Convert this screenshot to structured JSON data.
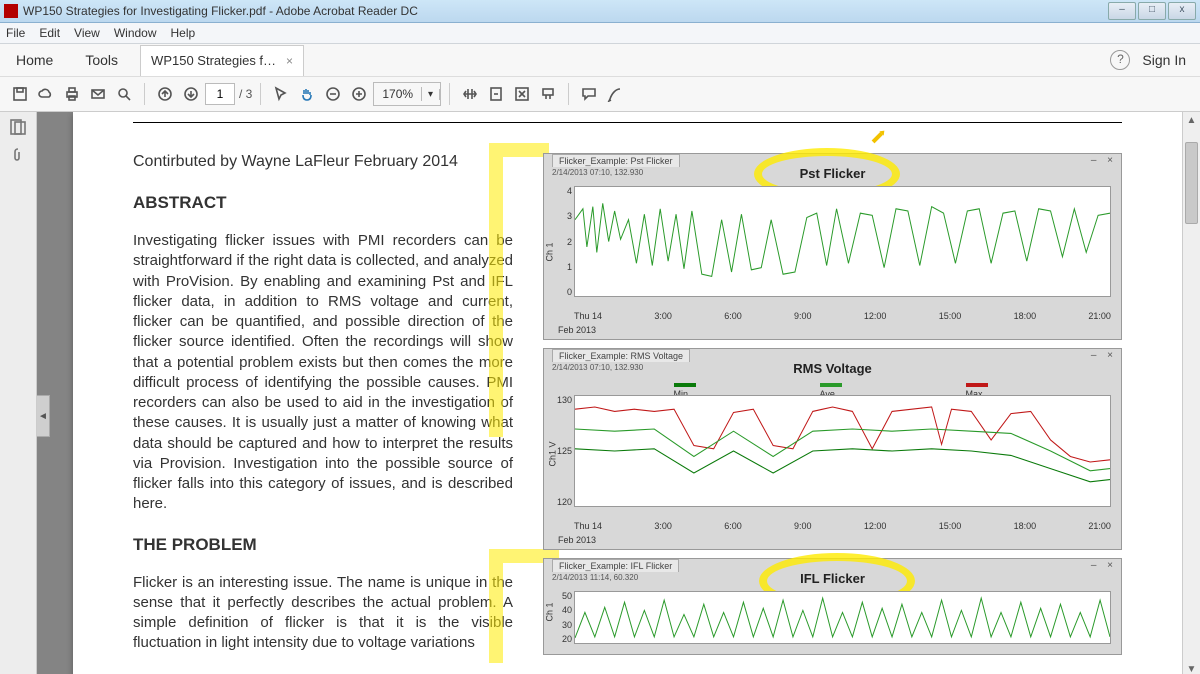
{
  "window": {
    "title": "WP150 Strategies for Investigating Flicker.pdf - Adobe Acrobat Reader DC",
    "min": "–",
    "max": "□",
    "close": "x"
  },
  "menu": {
    "file": "File",
    "edit": "Edit",
    "view": "View",
    "window": "Window",
    "help": "Help"
  },
  "tabrow": {
    "home": "Home",
    "tools": "Tools",
    "doctab": "WP150 Strategies f…",
    "close_x": "×",
    "help": "?",
    "signin": "Sign In"
  },
  "toolbar": {
    "page_current": "1",
    "page_total": "/ 3",
    "zoom": "170%"
  },
  "doc": {
    "contributed": "Contirbuted by Wayne LaFleur February 2014",
    "h_abstract": "ABSTRACT",
    "abstract": "Investigating flicker issues with PMI recorders can be straightforward if the right data is collected, and analyzed with ProVision. By enabling and examining Pst and IFL flicker data, in addition to RMS voltage and current, flicker can be quantified, and possible direction of the flicker source identified. Often the recordings will show that a potential problem exists but then comes the more difficult process of identifying the possible causes. PMI recorders can also be used to aid in the investigation of these causes. It is usually just a matter of knowing what data should be captured and how to interpret the results via Provision. Investigation into the possible source of flicker falls into this category of issues, and is described here.",
    "h_problem": "THE PROBLEM",
    "problem": "Flicker is an interesting issue. The name is unique in the sense that it perfectly describes the actual problem. A simple definition of flicker is that it is the visible fluctuation in light intensity due to voltage variations"
  },
  "chart_data": [
    {
      "type": "line",
      "title": "Pst Flicker",
      "tab": "Flicker_Example: Pst Flicker",
      "sub": "2/14/2013 07:10, 132.930",
      "ylabel": "Ch 1",
      "ylim": [
        0,
        4
      ],
      "yticks": [
        0,
        1,
        2,
        3,
        4
      ],
      "xticks": [
        "Thu 14",
        "3:00",
        "6:00",
        "9:00",
        "12:00",
        "15:00",
        "18:00",
        "21:00"
      ],
      "xunder": "Feb 2013",
      "series": [
        {
          "name": "Pst",
          "color": "#2a9a2a"
        }
      ]
    },
    {
      "type": "line",
      "title": "RMS Voltage",
      "tab": "Flicker_Example: RMS Voltage",
      "sub": "2/14/2013 07:10, 132.930",
      "ylabel": "Ch1 V",
      "ylim": [
        120,
        132
      ],
      "yticks": [
        120,
        125,
        130
      ],
      "xticks": [
        "Thu 14",
        "3:00",
        "6:00",
        "9:00",
        "12:00",
        "15:00",
        "18:00",
        "21:00"
      ],
      "xunder": "Feb 2013",
      "legend": [
        {
          "name": "Min",
          "color": "#0a7a0a"
        },
        {
          "name": "Ave",
          "color": "#2a9a2a"
        },
        {
          "name": "Max",
          "color": "#c01818"
        }
      ]
    },
    {
      "type": "line",
      "title": "IFL Flicker",
      "tab": "Flicker_Example: IFL Flicker",
      "sub": "2/14/2013 11:14, 60.320",
      "ylabel": "Ch 1",
      "ylim": [
        0,
        55
      ],
      "yticks": [
        20,
        30,
        40,
        50
      ],
      "series": [
        {
          "name": "IFL",
          "color": "#2a9a2a"
        }
      ]
    }
  ]
}
